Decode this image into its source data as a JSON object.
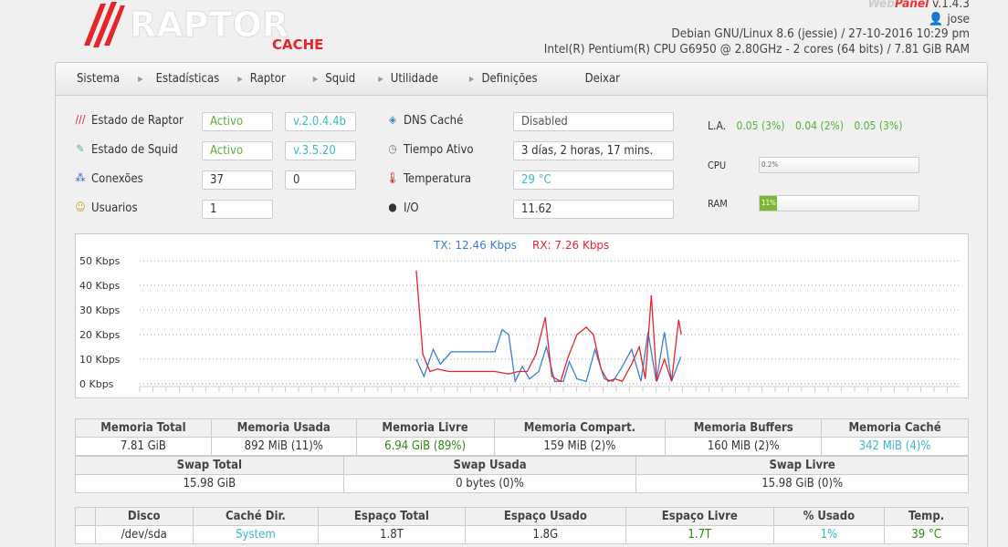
{
  "logo": {
    "text": "RAPTOR",
    "sub": "CACHE"
  },
  "header": {
    "webpanel_a": "Web",
    "webpanel_b": "Panel",
    "version": "v.1.4.3",
    "user": "jose",
    "os": "Debian GNU/Linux 8.6 (jessie) / 27-10-2016 10:29 pm",
    "cpu": "Intel(R) Pentium(R) CPU G6950 @ 2.80GHz - 2 cores (64 bits)  / 7.81 GiB RAM"
  },
  "nav": [
    "Sistema",
    "Estadísticas",
    "Raptor",
    "Squid",
    "Utilidade",
    "Definições",
    "Deixar"
  ],
  "status": {
    "raptor": {
      "label": "Estado de Raptor",
      "state": "Activo",
      "version": "v.2.0.4.4b"
    },
    "squid": {
      "label": "Estado de Squid",
      "state": "Activo",
      "version": "v.3.5.20"
    },
    "conn": {
      "label": "Conexões",
      "a": "37",
      "b": "0"
    },
    "users": {
      "label": "Usuarios",
      "a": "1"
    },
    "dns": {
      "label": "DNS Caché",
      "value": "Disabled"
    },
    "uptime": {
      "label": "Tiempo Ativo",
      "value": "3 días, 2 horas, 17 mins."
    },
    "temp": {
      "label": "Temperatura",
      "value": "29 °C"
    },
    "io": {
      "label": "I/O",
      "value": "11.62"
    }
  },
  "load": {
    "label": "L.A.",
    "v1": "0.05 (3%)",
    "v2": "0.04 (2%)",
    "v3": "0.05 (3%)"
  },
  "cpu": {
    "label": "CPU",
    "text": "0.2%",
    "percent": 0.2
  },
  "ram": {
    "label": "RAM",
    "text": "11%",
    "percent": 11
  },
  "chart_data": {
    "type": "line",
    "legend": {
      "tx": "TX: 12.46 Kbps",
      "rx": "RX: 7.26 Kbps"
    },
    "legend_position": "top-center",
    "yticks": [
      "50 Kbps",
      "40 Kbps",
      "30 Kbps",
      "20 Kbps",
      "10 Kbps",
      "0 Kbps"
    ],
    "ylim": [
      0,
      50
    ],
    "xlim": [
      0,
      150
    ],
    "grid": true,
    "series": [
      {
        "name": "TX",
        "color": "#3a7fd5",
        "x": [
          50.6,
          52,
          53.7,
          55,
          57,
          65,
          66.3,
          67.5,
          68.7,
          70,
          71.3,
          73,
          74.4,
          75.9,
          77.5,
          78.6,
          80,
          81.7,
          83.3,
          85,
          86.6,
          88.3,
          90,
          91.7,
          93,
          94.5,
          96,
          97.3,
          99
        ],
        "y": [
          10,
          3,
          14,
          8,
          13,
          13,
          22,
          20,
          1,
          7,
          2,
          5,
          15,
          1,
          1,
          9,
          2,
          1,
          14,
          2,
          1,
          7,
          14,
          1,
          21,
          1,
          21,
          1,
          11
        ]
      },
      {
        "name": "RX",
        "color": "#e8242b",
        "x": [
          50.6,
          51.8,
          53.1,
          54.5,
          56.5,
          65,
          67.5,
          69.2,
          70.9,
          72.5,
          74.2,
          75.4,
          77,
          78.4,
          80,
          81.7,
          83,
          84.4,
          85.7,
          87,
          88.3,
          90,
          91.4,
          92.5,
          93.6,
          94.6,
          96,
          97.3,
          98.6,
          99.1
        ],
        "y": [
          46,
          12,
          5,
          6,
          5,
          5,
          4,
          5,
          5,
          12,
          27,
          3,
          1,
          11,
          20,
          23,
          20,
          6,
          1,
          2,
          1,
          8,
          15,
          2,
          36,
          1,
          10,
          1,
          26,
          20
        ]
      }
    ]
  },
  "memory": {
    "headers": [
      "Memoria Total",
      "Memoria Usada",
      "Memoria Livre",
      "Memoria Compart.",
      "Memoria Buffers",
      "Memoria Caché"
    ],
    "values": [
      "7.81 GiB",
      "892 MiB (11)%",
      "6.94 GiB (89%)",
      "159 MiB (2)%",
      "160 MiB (2)%",
      "342 MiB (4)%"
    ]
  },
  "swap": {
    "headers": [
      "Swap Total",
      "Swap Usada",
      "Swap Livre"
    ],
    "values": [
      "15.98 GiB",
      "0 bytes (0)%",
      "15.98 GiB (0)%"
    ]
  },
  "disk": {
    "headers": [
      "",
      "Disco",
      "Caché Dir.",
      "Espaço Total",
      "Espaço Usado",
      "Espaço Livre",
      "% Usado",
      "Temp."
    ],
    "values": [
      "",
      "/dev/sda",
      "System",
      "1.8T",
      "1.8G",
      "1.7T",
      "1%",
      "39 °C"
    ]
  },
  "colors": {
    "accent": "#e8242b",
    "green": "#5ab13c",
    "cyan": "#3bb8cf"
  }
}
